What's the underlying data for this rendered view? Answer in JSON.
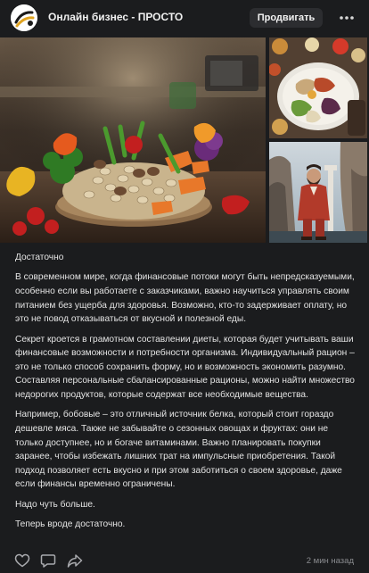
{
  "header": {
    "channel_name": "Онлайн бизнес - ПРОСТО",
    "promote_label": "Продвигать"
  },
  "post": {
    "paragraphs": [
      "Достаточно",
      "В современном мире, когда финансовые потоки могут быть непредсказуемыми, особенно если вы работаете с заказчиками, важно научиться управлять своим питанием без ущерба для здоровья. Возможно, кто-то задерживает оплату, но это не повод отказываться от вкусной и полезной еды.",
      "Секрет кроется в грамотном составлении диеты, которая будет учитывать ваши финансовые возможности и потребности организма. Индивидуальный рацион – это не только способ сохранить форму, но и возможность экономить разумно. Составляя персональные сбалансированные рационы, можно найти множество недорогих продуктов, которые содержат все необходимые вещества.",
      "Например, бобовые – это отличный источник белка, который стоит гораздо дешевле мяса. Также не забывайте о сезонных овощах и фруктах: они не только доступнее, но и богаче витаминами. Важно планировать покупки заранее, чтобы избежать лишних трат на импульсные приобретения. Такой подход позволяет есть вкусно и при этом заботиться о своем здоровье, даже если финансы временно ограничены.",
      "Надо чуть больше.",
      "Теперь вроде достаточно."
    ]
  },
  "footer": {
    "timestamp": "2 мин назад"
  },
  "icons": {
    "avatar": "channel-logo-icon",
    "more": "more-dots-icon",
    "like": "heart-icon",
    "comment": "comment-icon",
    "share": "share-arrow-icon"
  },
  "colors": {
    "background": "#1b1c1e",
    "button_bg": "#2c2d30",
    "text": "#e4e4e4",
    "muted": "#8a8b8f"
  }
}
